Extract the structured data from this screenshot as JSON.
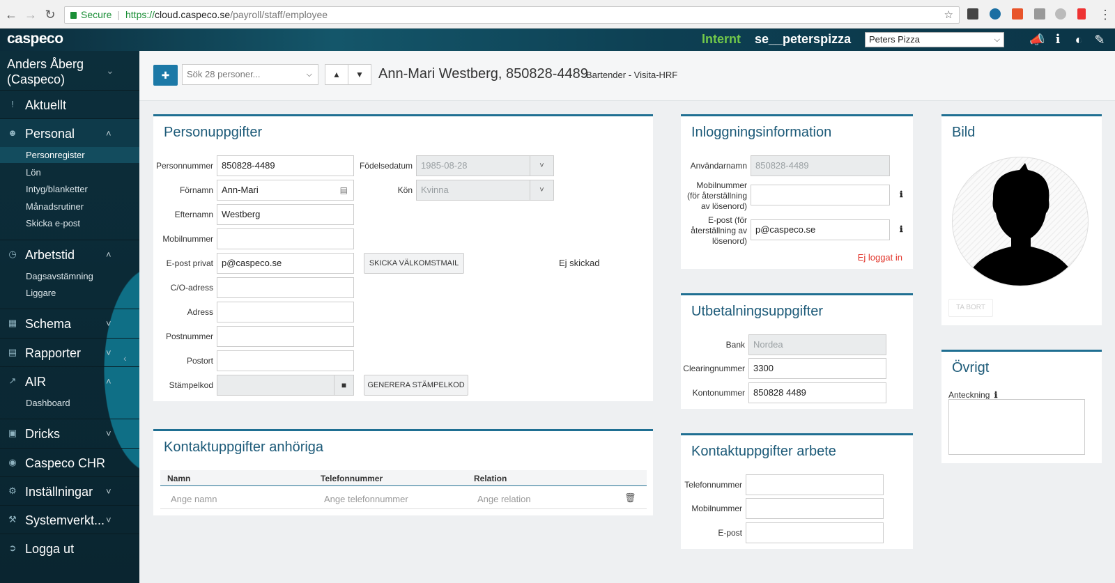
{
  "browser": {
    "secure_label": "Secure",
    "url_protocol": "https://",
    "url_host": "cloud.caspeco.se",
    "url_path": "/payroll/staff/employee"
  },
  "topbar": {
    "logo": "caspeco",
    "env_label": "Internt",
    "company_code": "se__peterspizza",
    "company_select": "Peters Pizza"
  },
  "sidebar": {
    "user_line1": "Anders Åberg",
    "user_line2": "(Caspeco)",
    "items": [
      {
        "label": "Aktuellt",
        "icon": "exclamation-icon"
      },
      {
        "label": "Personal",
        "icon": "users-icon",
        "subitems": [
          "Personregister",
          "Lön",
          "Intyg/blanketter",
          "Månadsrutiner",
          "Skicka e-post"
        ]
      },
      {
        "label": "Arbetstid",
        "icon": "clock-icon",
        "subitems": [
          "Dagsavstämning",
          "Liggare"
        ]
      },
      {
        "label": "Schema",
        "icon": "calendar-icon"
      },
      {
        "label": "Rapporter",
        "icon": "report-icon"
      },
      {
        "label": "AIR",
        "icon": "chart-icon",
        "subitems": [
          "Dashboard"
        ]
      },
      {
        "label": "Dricks",
        "icon": "money-icon"
      },
      {
        "label": "Caspeco CHR",
        "icon": "user-circle-icon"
      },
      {
        "label": "Inställningar",
        "icon": "gear-icon"
      },
      {
        "label": "Systemverkt...",
        "icon": "wrench-icon"
      },
      {
        "label": "Logga ut",
        "icon": "logout-icon"
      }
    ]
  },
  "toolbar": {
    "search_placeholder": "Sök 28 personer...",
    "employee_title": "Ann-Mari Westberg, 850828-4489",
    "employee_role": "Bartender - Visita-HRF"
  },
  "personuppgifter": {
    "title": "Personuppgifter",
    "labels": {
      "personnummer": "Personnummer",
      "fornamn": "Förnamn",
      "efternamn": "Efternamn",
      "mobilnummer": "Mobilnummer",
      "epost": "E-post privat",
      "co_adress": "C/O-adress",
      "adress": "Adress",
      "postnummer": "Postnummer",
      "postort": "Postort",
      "stampelkod": "Stämpelkod",
      "fodelsedatum": "Födelsedatum",
      "kon": "Kön"
    },
    "values": {
      "personnummer": "850828-4489",
      "fornamn": "Ann-Mari",
      "efternamn": "Westberg",
      "mobilnummer": "",
      "epost": "p@caspeco.se",
      "co_adress": "",
      "adress": "",
      "postnummer": "",
      "postort": "",
      "stampelkod": "",
      "fodelsedatum": "1985-08-28",
      "kon": "Kvinna"
    },
    "welcome_button": "SKICKA VÄLKOMSTMAIL",
    "welcome_status": "Ej skickad",
    "generate_button": "GENERERA STÄMPELKOD"
  },
  "anhoriga": {
    "title": "Kontaktuppgifter anhöriga",
    "columns": [
      "Namn",
      "Telefonnummer",
      "Relation"
    ],
    "placeholders": [
      "Ange namn",
      "Ange telefonnummer",
      "Ange relation"
    ]
  },
  "inloggning": {
    "title": "Inloggningsinformation",
    "label_username": "Användarnamn",
    "label_mobile": [
      "Mobilnummer",
      "(för återställning",
      "av lösenord)"
    ],
    "label_email": [
      "E-post (för",
      "återställning av",
      "lösenord)"
    ],
    "username": "850828-4489",
    "mobile": "",
    "email": "p@caspeco.se",
    "status": "Ej loggat in",
    "status_color": "#e2352b"
  },
  "utbetalning": {
    "title": "Utbetalningsuppgifter",
    "label_bank": "Bank",
    "label_clearing": "Clearingnummer",
    "label_konto": "Kontonummer",
    "bank": "Nordea",
    "clearing": "3300",
    "konto": "850828 4489"
  },
  "arbete": {
    "title": "Kontaktuppgifter arbete",
    "label_telefon": "Telefonnummer",
    "label_mobil": "Mobilnummer",
    "label_epost": "E-post"
  },
  "bild": {
    "title": "Bild",
    "remove_button": "TA BORT"
  },
  "ovrigt": {
    "title": "Övrigt",
    "label_anteckning": "Anteckning"
  },
  "colors": {
    "accent": "#1f6f92",
    "env_green": "#72c94a",
    "primary_button": "#1c79a7"
  }
}
